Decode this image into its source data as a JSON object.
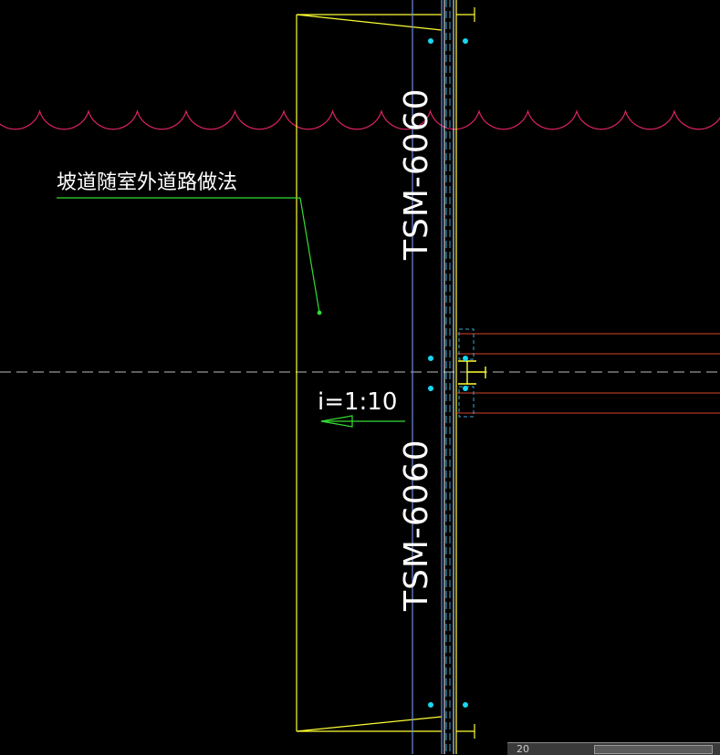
{
  "drawing": {
    "note_label": "坡道随室外道路做法",
    "slope_label": "i=1:10",
    "section_label_upper": "TSM-6060",
    "section_label_lower": "TSM-6060"
  },
  "colors": {
    "background": "#000000",
    "outline": "#ffff33",
    "column_line": "#6f8fe6",
    "grid_line": "#bdbdbd",
    "revision_cloud": "#e0245e",
    "leader": "#33dd33",
    "beam": "#d9432a",
    "point_marker": "#18d7f0",
    "dashed_cyan": "#37a9d9",
    "text": "#ffffff"
  },
  "status_bar": {
    "value": "20"
  }
}
